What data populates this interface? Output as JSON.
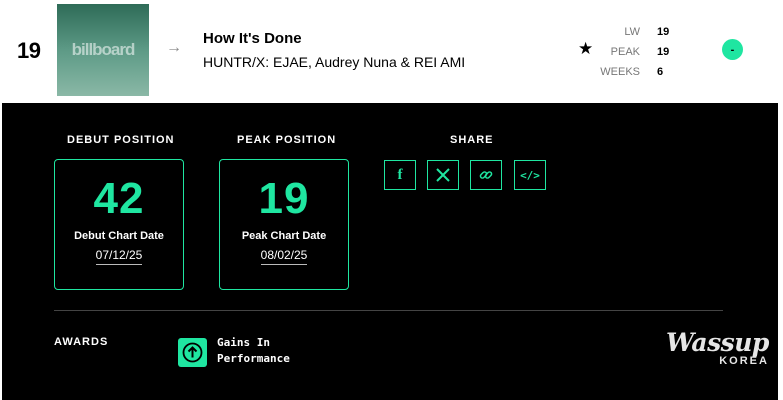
{
  "entry": {
    "rank": "19",
    "cover_logo": "billboard",
    "title": "How It's Done",
    "artist": "HUNTR/X: EJAE, Audrey Nuna & REI AMI",
    "trend_symbol": "-",
    "stats": [
      {
        "label": "LW",
        "value": "19"
      },
      {
        "label": "PEAK",
        "value": "19"
      },
      {
        "label": "WEEKS",
        "value": "6"
      }
    ]
  },
  "details": {
    "debut": {
      "heading": "DEBUT POSITION",
      "number": "42",
      "caption": "Debut Chart Date",
      "date": "07/12/25"
    },
    "peak": {
      "heading": "PEAK POSITION",
      "number": "19",
      "caption": "Peak Chart Date",
      "date": "08/02/25"
    },
    "share": {
      "heading": "SHARE",
      "buttons": [
        "facebook-icon",
        "x-icon",
        "link-icon",
        "embed-icon"
      ]
    },
    "awards": {
      "heading": "AWARDS",
      "line1": "Gains In",
      "line2": "Performance"
    }
  },
  "watermark": {
    "brand": "Wassup",
    "sub": "KOREA"
  },
  "colors": {
    "accent": "#1fe6a1",
    "panel": "#000000"
  }
}
